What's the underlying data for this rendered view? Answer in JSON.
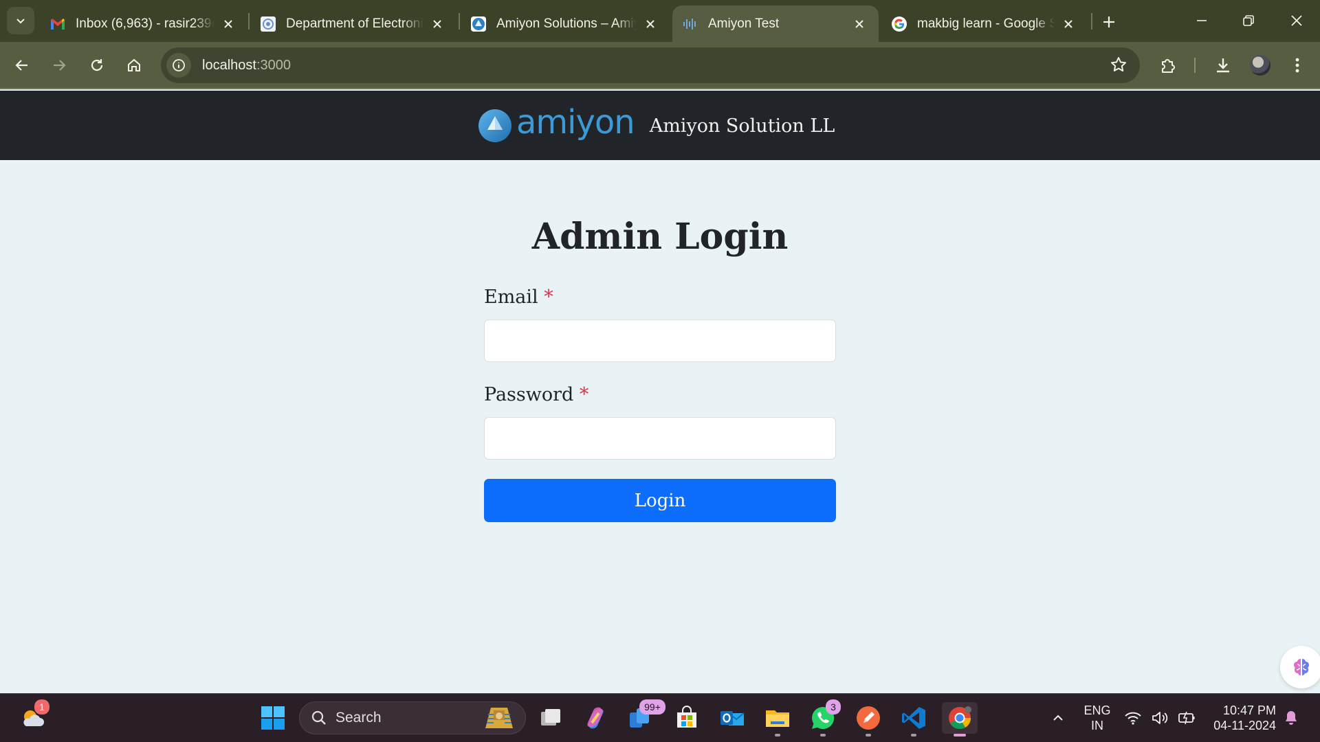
{
  "browser": {
    "tabs": [
      {
        "title": "Inbox (6,963) - rasir239@",
        "favicon": "gmail-icon",
        "active": false
      },
      {
        "title": "Department of Electronic",
        "favicon": "department-site-icon",
        "active": false
      },
      {
        "title": "Amiyon Solutions – Amiy",
        "favicon": "amiyon-icon",
        "active": false
      },
      {
        "title": "Amiyon Test",
        "favicon": "audio-wave-icon",
        "active": true
      },
      {
        "title": "makbig learn - Google Se",
        "favicon": "google-icon",
        "active": false
      }
    ],
    "address": {
      "host": "localhost",
      "port": ":3000"
    }
  },
  "header": {
    "logo_text": "amiyon",
    "company_name": "Amiyon Solution LL"
  },
  "login": {
    "title": "Admin Login",
    "email_label": "Email",
    "password_label": "Password",
    "required_mark": "*",
    "email_value": "",
    "password_value": "",
    "submit_label": "Login"
  },
  "taskbar": {
    "weather_badge": "1",
    "search_placeholder": "Search",
    "store_badge": "99+",
    "whatsapp_badge": "3",
    "language": "ENG",
    "region": "IN",
    "time": "10:47 PM",
    "date": "04-11-2024"
  },
  "colors": {
    "accent": "#0d6efd",
    "header_bg": "#212529",
    "page_bg": "#e9f2f5",
    "required": "#dc3545",
    "brand_blue": "#3c9ad8"
  }
}
